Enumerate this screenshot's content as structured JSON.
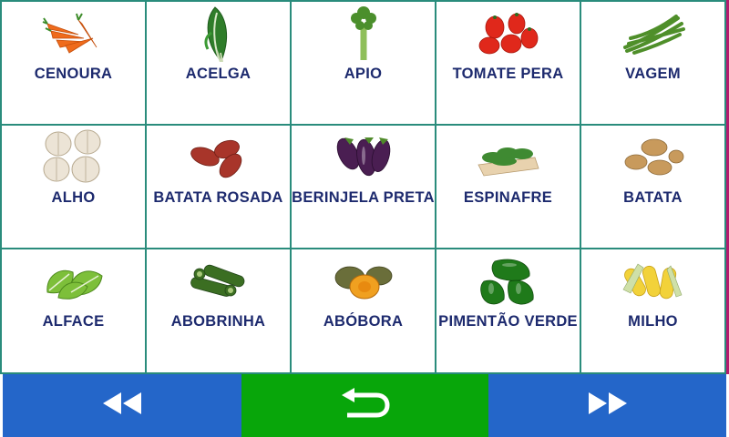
{
  "vegetables": [
    {
      "label": "CENOURA",
      "icon": "carrot-icon"
    },
    {
      "label": "ACELGA",
      "icon": "chard-icon"
    },
    {
      "label": "APIO",
      "icon": "celery-icon"
    },
    {
      "label": "TOMATE PERA",
      "icon": "tomato-icon"
    },
    {
      "label": "VAGEM",
      "icon": "green-bean-icon"
    },
    {
      "label": "ALHO",
      "icon": "garlic-icon"
    },
    {
      "label": "BATATA ROSADA",
      "icon": "sweet-potato-icon"
    },
    {
      "label": "BERINJELA PRETA",
      "icon": "eggplant-icon"
    },
    {
      "label": "ESPINAFRE",
      "icon": "spinach-icon"
    },
    {
      "label": "BATATA",
      "icon": "potato-icon"
    },
    {
      "label": "ALFACE",
      "icon": "lettuce-icon"
    },
    {
      "label": "ABOBRINHA",
      "icon": "zucchini-icon"
    },
    {
      "label": "ABÓBORA",
      "icon": "pumpkin-icon"
    },
    {
      "label": "PIMENTÃO VERDE",
      "icon": "green-pepper-icon"
    },
    {
      "label": "MILHO",
      "icon": "corn-icon"
    }
  ],
  "navigation": {
    "previous_icon": "rewind-icon",
    "back_icon": "return-arrow-icon",
    "next_icon": "fast-forward-icon"
  },
  "colors": {
    "grid_line": "#2a8c7c",
    "label_text": "#1d2a6e",
    "nav_blue": "#2466c9",
    "nav_green": "#08a60a"
  }
}
